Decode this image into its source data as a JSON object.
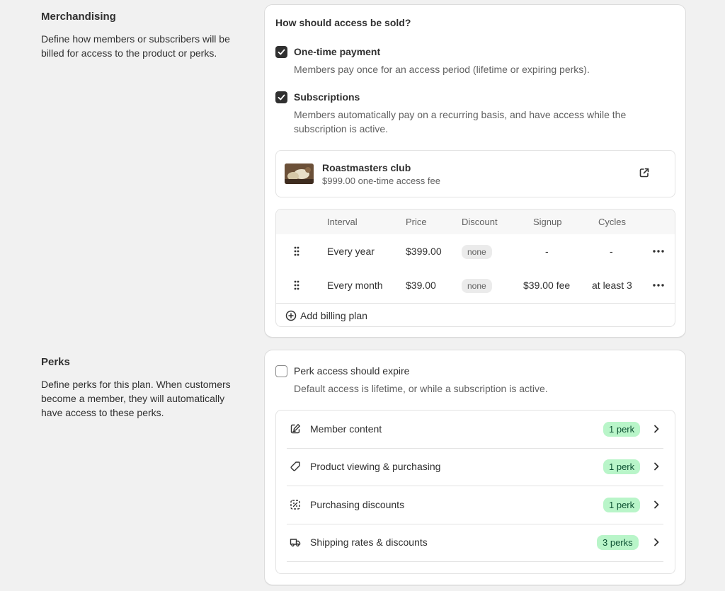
{
  "merchandising": {
    "title": "Merchandising",
    "description": "Define how members or subscribers will be billed for access to the product or perks.",
    "question": "How should access be sold?",
    "options": [
      {
        "label": "One-time payment",
        "description": "Members pay once for an access period (lifetime or expiring perks).",
        "checked": true
      },
      {
        "label": "Subscriptions",
        "description": "Members automatically pay on a recurring basis, and have access while the subscription is active.",
        "checked": true
      }
    ],
    "product": {
      "name": "Roastmasters club",
      "price": "$999.00 one-time access fee",
      "external_icon": "external-link-icon"
    },
    "billing_table": {
      "headers": [
        "Interval",
        "Price",
        "Discount",
        "Signup",
        "Cycles"
      ],
      "rows": [
        {
          "interval": "Every year",
          "price": "$399.00",
          "discount": "none",
          "signup": "-",
          "cycles": "-"
        },
        {
          "interval": "Every month",
          "price": "$39.00",
          "discount": "none",
          "signup": "$39.00 fee",
          "cycles": "at least 3"
        }
      ],
      "add_label": "Add billing plan"
    }
  },
  "perks": {
    "title": "Perks",
    "description": "Define perks for this plan. When customers become a member, they will automatically have access to these perks.",
    "expire_option": {
      "label": "Perk access should expire",
      "description": "Default access is lifetime, or while a subscription is active.",
      "checked": false
    },
    "items": [
      {
        "label": "Member content",
        "badge": "1 perk",
        "icon": "edit-document-icon"
      },
      {
        "label": "Product viewing & purchasing",
        "badge": "1 perk",
        "icon": "tag-icon"
      },
      {
        "label": "Purchasing discounts",
        "badge": "1 perk",
        "icon": "discount-icon"
      },
      {
        "label": "Shipping rates & discounts",
        "badge": "3 perks",
        "icon": "truck-icon"
      }
    ]
  },
  "colors": {
    "badge_green": "#b9f5c9",
    "checkbox_dark": "#303030",
    "background": "#f1f1f1"
  }
}
